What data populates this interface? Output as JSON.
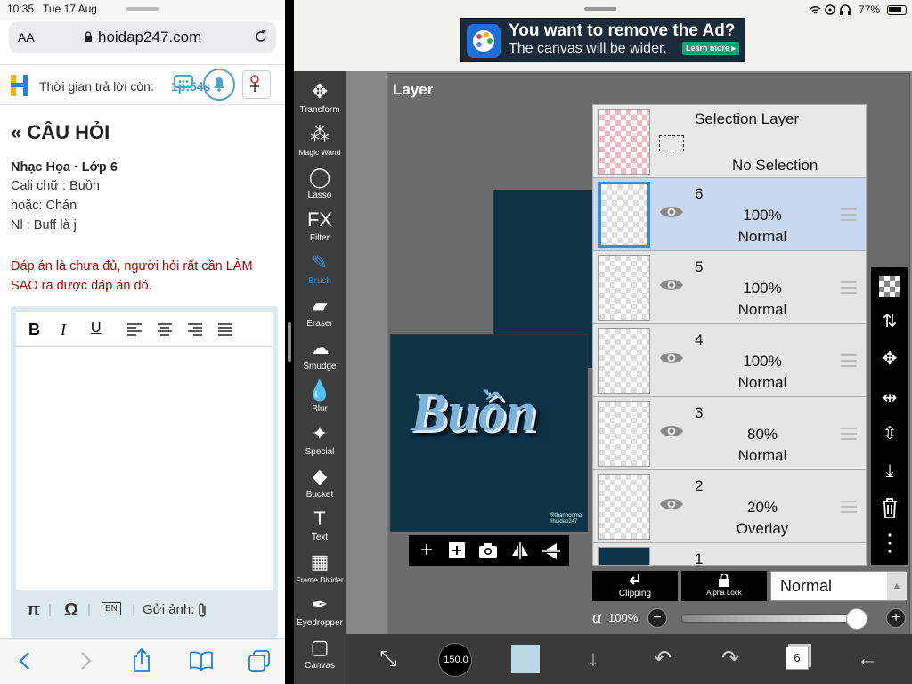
{
  "safari": {
    "status": {
      "time": "10:35",
      "date": "Tue 17 Aug"
    },
    "address": {
      "aa": "AA",
      "url": "hoidap247.com"
    },
    "site": {
      "timer_label": "Thời gian trả lời còn:",
      "timer_value": "1p:54s"
    },
    "question": {
      "heading": "CÂU HỎI",
      "subject": "Nhạc Họa · Lớp 6",
      "lines": [
        "Cali chữ : Buồn",
        "hoặc: Chán",
        "Nl : Buff là j"
      ],
      "warning": "Đáp án là chưa đủ, người hỏi rất cần LÀM SAO ra được đáp án đó."
    },
    "editor": {
      "buttons": [
        "B",
        "I",
        "U"
      ],
      "pi": "π",
      "omega": "Ω",
      "lang": "EN",
      "send_image": "Gửi ảnh:"
    }
  },
  "ibis": {
    "status": {
      "battery": "77%"
    },
    "ad": {
      "line1": "You want to remove the Ad?",
      "line2": "The canvas will be wider.",
      "cta": "Learn more ▸"
    },
    "tools": [
      "Transform",
      "Magic Wand",
      "Lasso",
      "Filter",
      "Brush",
      "Eraser",
      "Smudge",
      "Blur",
      "Special",
      "Bucket",
      "Text",
      "Frame Divider",
      "Eyedropper",
      "Canvas"
    ],
    "active_tool": "Brush",
    "layer_panel": {
      "title": "Layer",
      "selection": {
        "title": "Selection Layer",
        "status": "No Selection"
      },
      "layers": [
        {
          "num": "6",
          "opacity": "100%",
          "mode": "Normal",
          "selected": true
        },
        {
          "num": "5",
          "opacity": "100%",
          "mode": "Normal",
          "selected": false
        },
        {
          "num": "4",
          "opacity": "100%",
          "mode": "Normal",
          "selected": false
        },
        {
          "num": "3",
          "opacity": "80%",
          "mode": "Normal",
          "selected": false
        },
        {
          "num": "2",
          "opacity": "20%",
          "mode": "Overlay",
          "selected": false
        },
        {
          "num": "1",
          "opacity": "",
          "mode": "",
          "selected": false
        }
      ],
      "clipping": "Clipping",
      "alpha_lock": "Alpha Lock",
      "blend_mode": "Normal",
      "alpha_label": "α",
      "alpha_value": "100%",
      "alpha_fraction": 1.0
    },
    "artwork": {
      "text": "Buồn",
      "credit1": "@thanhonmai",
      "credit2": "#hoidap247"
    },
    "bottom": {
      "brush_size": "150.0",
      "layer_count": "6"
    },
    "colors": {
      "selected_layer": "#c9d8ee",
      "current_color": "#bcd7e6",
      "artwork_bg": "#0d3348",
      "accent": "#2f8fe0",
      "warning": "#b00000"
    }
  }
}
